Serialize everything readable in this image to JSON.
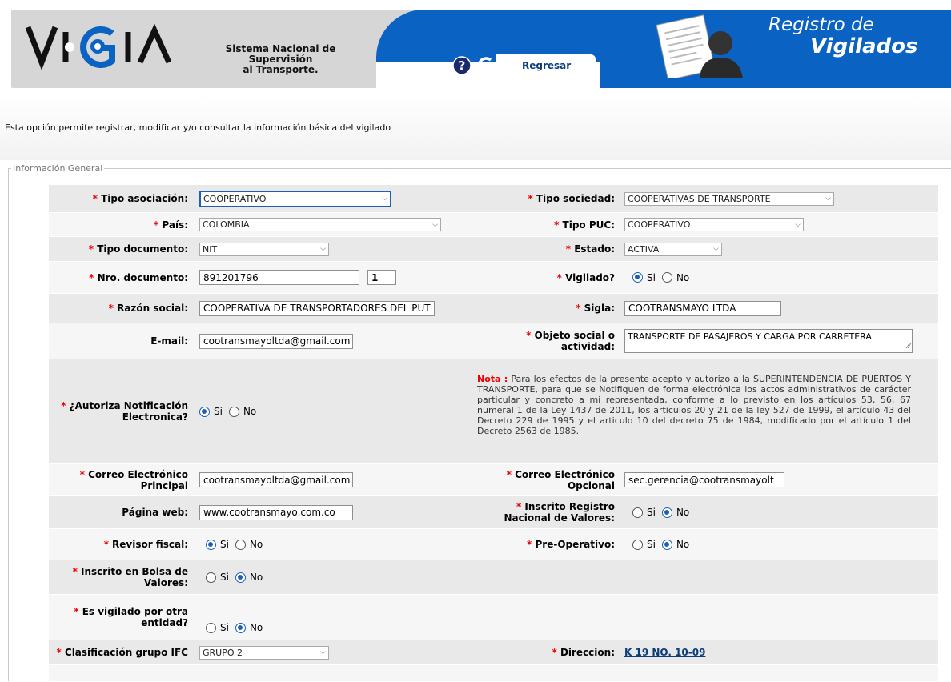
{
  "header": {
    "logo_text": "VIGIA",
    "subtitle_line1": "Sistema Nacional de Supervisión",
    "subtitle_line2": "al Transporte.",
    "regresar": "Regresar",
    "title_line1": "Registro de",
    "title_line2": "Vigilados"
  },
  "intro": "Esta opción permite registrar, modificar y/o consultar la información básica del vigilado",
  "legend": "Información General",
  "fields": {
    "tipo_asociacion": {
      "label": "Tipo asociación:",
      "value": "COOPERATIVO"
    },
    "tipo_sociedad": {
      "label": "Tipo sociedad:",
      "value": "COOPERATIVAS DE TRANSPORTE"
    },
    "pais": {
      "label": "País:",
      "value": "COLOMBIA"
    },
    "tipo_puc": {
      "label": "Tipo PUC:",
      "value": "COOPERATIVO"
    },
    "tipo_documento": {
      "label": "Tipo documento:",
      "value": "NIT"
    },
    "estado": {
      "label": "Estado:",
      "value": "ACTIVA"
    },
    "nro_documento": {
      "label": "Nro. documento:",
      "value": "891201796",
      "dv": "1"
    },
    "vigilado": {
      "label": "Vigilado?",
      "si": "Si",
      "no": "No"
    },
    "razon_social": {
      "label": "Razón social:",
      "value": "COOPERATIVA DE TRANSPORTADORES DEL PUT"
    },
    "sigla": {
      "label": "Sigla:",
      "value": "COOTRANSMAYO LTDA"
    },
    "email": {
      "label": "E-mail:",
      "value": "cootransmayoltda@gmail.com"
    },
    "objeto_social": {
      "label1": "Objeto social o",
      "label2": "actividad:",
      "value": "TRANSPORTE DE PASAJEROS Y CARGA POR CARRETERA"
    },
    "autoriza": {
      "label1": "¿Autoriza Notificación",
      "label2": "Electronica?",
      "si": "Si",
      "no": "No"
    },
    "nota_title": "Nota :",
    "nota_text": "Para los efectos de la presente acepto y autorizo a la SUPERINTENDENCIA DE PUERTOS Y TRANSPORTE, para que se Notifiquen de forma electrónica los actos administrativos de carácter particular y concreto a mi representada, conforme a lo previsto en los artículos 53, 56, 67 numeral 1 de la Ley 1437 de 2011, los artículos 20 y 21 de la ley 527 de 1999, el artículo 43 del Decreto 229 de 1995 y el articulo 10 del decreto 75 de 1984, modificado por el artículo 1 del Decreto 2563 de 1985.",
    "correo_principal": {
      "label1": "Correo Electrónico",
      "label2": "Principal",
      "value": "cootransmayoltda@gmail.com"
    },
    "correo_opcional": {
      "label1": "Correo Electrónico",
      "label2": "Opcional",
      "value": "sec.gerencia@cootransmayolt"
    },
    "pagina_web": {
      "label": "Página web:",
      "value": "www.cootransmayo.com.co"
    },
    "inscrito_rnv": {
      "label1": "Inscrito Registro",
      "label2": "Nacional de Valores:",
      "si": "Si",
      "no": "No"
    },
    "revisor_fiscal": {
      "label": "Revisor fiscal:",
      "si": "Si",
      "no": "No"
    },
    "pre_operativo": {
      "label": "Pre-Operativo:",
      "si": "Si",
      "no": "No"
    },
    "bolsa": {
      "label1": "Inscrito en Bolsa de",
      "label2": "Valores:",
      "si": "Si",
      "no": "No"
    },
    "otra_entidad": {
      "label1": "Es vigilado por otra",
      "label2": "entidad?",
      "si": "Si",
      "no": "No"
    },
    "grupo_ifc": {
      "label": "Clasificación grupo IFC",
      "value": "GRUPO 2"
    },
    "direccion": {
      "label": "Direccion:",
      "value": "K 19 NO. 10-09"
    }
  }
}
